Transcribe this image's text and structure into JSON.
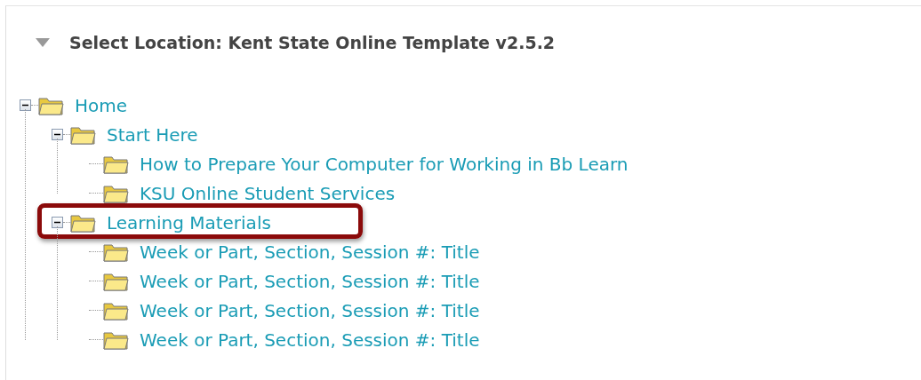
{
  "panel": {
    "title": "Select Location: Kent State Online Template v2.5.2",
    "expanded": true
  },
  "tree": [
    {
      "label": "Home",
      "expanded": true,
      "highlighted": false,
      "children": [
        {
          "label": "Start Here",
          "expanded": true,
          "highlighted": false,
          "children": [
            {
              "label": "How to Prepare Your Computer for Working in Bb Learn",
              "highlighted": false
            },
            {
              "label": "KSU Online Student Services",
              "highlighted": false
            }
          ]
        },
        {
          "label": "Learning Materials",
          "expanded": true,
          "highlighted": true,
          "children": [
            {
              "label": "Week or Part, Section, Session #: Title",
              "highlighted": false
            },
            {
              "label": "Week or Part, Section, Session #: Title",
              "highlighted": false
            },
            {
              "label": "Week or Part, Section, Session #: Title",
              "highlighted": false
            },
            {
              "label": "Week or Part, Section, Session #: Title",
              "highlighted": false
            }
          ]
        }
      ]
    }
  ]
}
